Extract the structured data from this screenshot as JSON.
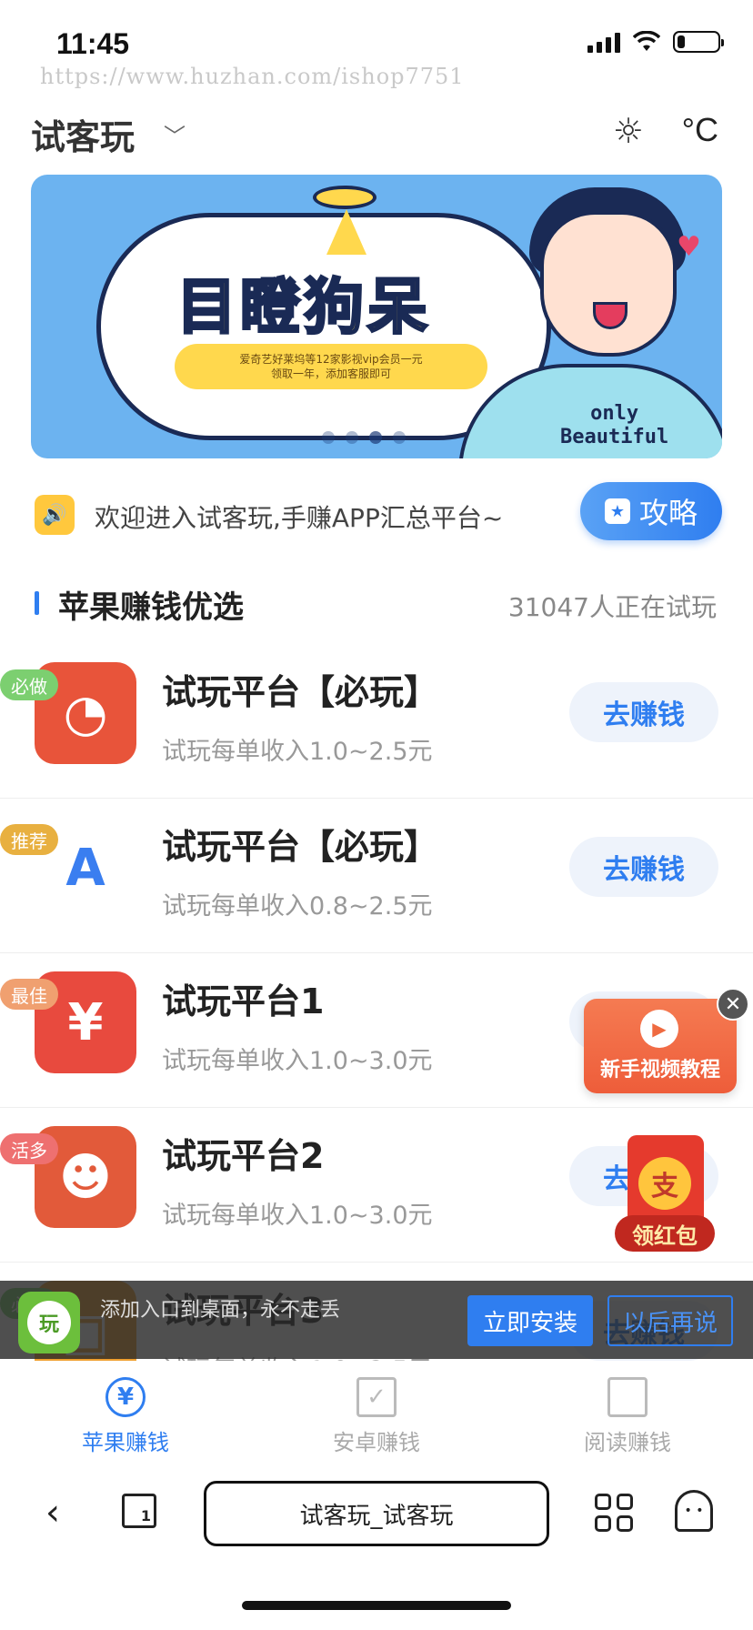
{
  "status_bar": {
    "time": "11:45",
    "battery_level": 0.2
  },
  "watermark": "https://www.huzhan.com/ishop7751",
  "header": {
    "title": "试客玩",
    "temperature_unit": "°C"
  },
  "banner": {
    "headline": "目瞪狗呆",
    "pill_line1": "爱奇艺好莱坞等12家影视vip会员一元",
    "pill_line2": "领取一年，添加客服即可",
    "caption_line1": "only",
    "caption_line2": "Beautiful",
    "slide_count": 4,
    "active_slide": 3
  },
  "notice": {
    "text": "欢迎进入试客玩,手赚APP汇总平台~",
    "guide_label": "攻略"
  },
  "section": {
    "title": "苹果赚钱优选",
    "count_text": "31047人正在试玩"
  },
  "tasks": [
    {
      "name": "试玩平台【必玩】",
      "badge": "必做",
      "badge_color": "#7ccf70",
      "desc": "试玩每单收入1.0~2.5元",
      "button": "去赚钱",
      "icon_color": "#e8543a",
      "icon": "pie-icon"
    },
    {
      "name": "试玩平台【必玩】",
      "badge": "推荐",
      "badge_color": "#e8b040",
      "desc": "试玩每单收入0.8~2.5元",
      "button": "去赚钱",
      "icon_color": "#ffffff",
      "icon": "rocket-icon"
    },
    {
      "name": "试玩平台1",
      "badge": "最佳",
      "badge_color": "#f0a070",
      "desc": "试玩每单收入1.0~3.0元",
      "button": "去赚钱",
      "icon_color": "#e84a3e",
      "icon": "yuan-hexagon-icon"
    },
    {
      "name": "试玩平台2",
      "badge": "活多",
      "badge_color": "#ee7070",
      "desc": "试玩每单收入1.0~3.0元",
      "button": "去赚钱",
      "icon_color": "#e25a3a",
      "icon": "face-icon"
    },
    {
      "name": "试玩平台3",
      "badge": "必做",
      "badge_color": "#7ccf70",
      "desc": "试玩每单收入1.0~2.5元",
      "button": "去赚钱",
      "icon_color": "#f0a030",
      "icon": "app-icon"
    }
  ],
  "video_widget": {
    "label": "新手视频教程"
  },
  "redpack": {
    "label": "领红包",
    "coin": "支"
  },
  "install_bar": {
    "text": "添加入口到桌面，永不走丢",
    "install_label": "立即安装",
    "later_label": "以后再说",
    "logo_text": "玩"
  },
  "tabs": [
    {
      "label": "苹果赚钱",
      "icon": "yuan-circle-icon",
      "glyph": "¥",
      "active": true
    },
    {
      "label": "安卓赚钱",
      "icon": "checkbox-icon",
      "glyph": "✓",
      "active": false
    },
    {
      "label": "阅读赚钱",
      "icon": "book-icon",
      "glyph": "",
      "active": false
    }
  ],
  "browser": {
    "url_text": "试客玩_试客玩",
    "tab_count": "1"
  }
}
